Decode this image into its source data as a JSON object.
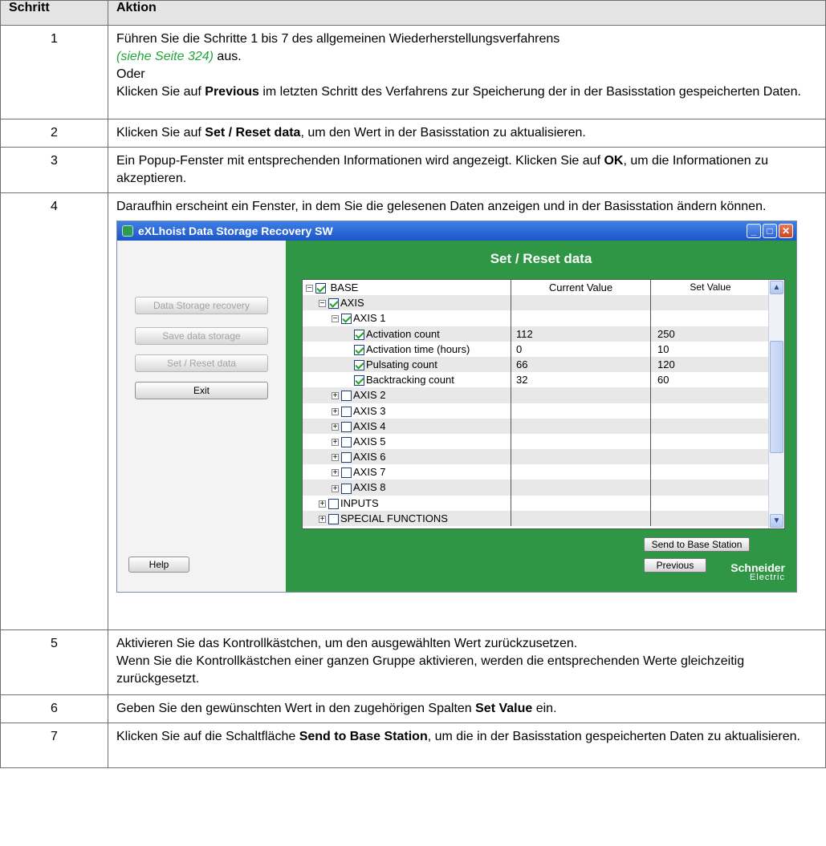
{
  "header": {
    "col_step": "Schritt",
    "col_action": "Aktion"
  },
  "rows": {
    "r1": {
      "num": "1",
      "line1": "Führen Sie die Schritte 1 bis 7 des allgemeinen Wiederherstellungsverfahrens",
      "link": "(siehe Seite 324)",
      "after_link": " aus.",
      "line_or": "Oder",
      "line3a": "Klicken Sie auf ",
      "line3b": "Previous",
      "line3c": " im letzten Schritt des Verfahrens zur Speicherung der in der Basisstation gespeicherten Daten."
    },
    "r2": {
      "num": "2",
      "a": "Klicken Sie auf ",
      "b": "Set / Reset data",
      "c": ", um den Wert in der Basisstation zu aktualisieren."
    },
    "r3": {
      "num": "3",
      "a": "Ein Popup-Fenster mit entsprechenden Informationen wird angezeigt. Klicken Sie auf ",
      "b": "OK",
      "c": ", um die Informationen zu akzeptieren."
    },
    "r4": {
      "num": "4",
      "a": "Daraufhin erscheint ein Fenster, in dem Sie die gelesenen Daten anzeigen und in der Basisstation ändern können."
    },
    "r5": {
      "num": "5",
      "a": "Aktivieren Sie das Kontrollkästchen, um den ausgewählten Wert zurückzusetzen.",
      "b": "Wenn Sie die Kontrollkästchen einer ganzen Gruppe aktivieren, werden die entsprechenden Werte gleichzeitig zurückgesetzt."
    },
    "r6": {
      "num": "6",
      "a": "Geben Sie den gewünschten Wert in den zugehörigen Spalten ",
      "b": "Set Value",
      "c": " ein."
    },
    "r7": {
      "num": "7",
      "a": "Klicken Sie auf die Schaltfläche ",
      "b": "Send to Base Station",
      "c": ", um die in der Basisstation gespeicherten Daten zu aktualisieren."
    }
  },
  "window": {
    "title": "eXLhoist Data Storage Recovery SW",
    "buttons": {
      "data_storage_recovery": "Data Storage recovery",
      "save_data_storage": "Save data storage",
      "set_reset_data": "Set / Reset data",
      "exit": "Exit",
      "help": "Help"
    },
    "panel_title": "Set / Reset data",
    "grid": {
      "col_current": "Current Value",
      "col_set": "Set Value",
      "rows": [
        {
          "label": "BASE",
          "current": "",
          "set": ""
        },
        {
          "label": "AXIS",
          "current": "",
          "set": ""
        },
        {
          "label": "AXIS 1",
          "current": "",
          "set": ""
        },
        {
          "label": "Activation count",
          "current": "112",
          "set": "250"
        },
        {
          "label": "Activation time (hours)",
          "current": "0",
          "set": "10"
        },
        {
          "label": "Pulsating count",
          "current": "66",
          "set": "120"
        },
        {
          "label": "Backtracking count",
          "current": "32",
          "set": "60"
        },
        {
          "label": "AXIS 2",
          "current": "",
          "set": ""
        },
        {
          "label": "AXIS 3",
          "current": "",
          "set": ""
        },
        {
          "label": "AXIS 4",
          "current": "",
          "set": ""
        },
        {
          "label": "AXIS 5",
          "current": "",
          "set": ""
        },
        {
          "label": "AXIS 6",
          "current": "",
          "set": ""
        },
        {
          "label": "AXIS 7",
          "current": "",
          "set": ""
        },
        {
          "label": "AXIS 8",
          "current": "",
          "set": ""
        },
        {
          "label": "INPUTS",
          "current": "",
          "set": ""
        },
        {
          "label": "SPECIAL FUNCTIONS",
          "current": "",
          "set": ""
        }
      ]
    },
    "send_button": "Send to Base Station",
    "previous_button": "Previous",
    "brand_line1": "Schneider",
    "brand_line2": "Electric",
    "colors": {
      "panel_green": "#2f9646",
      "titlebar_blue": "#1d55c9",
      "link_green": "#22a63a"
    }
  }
}
